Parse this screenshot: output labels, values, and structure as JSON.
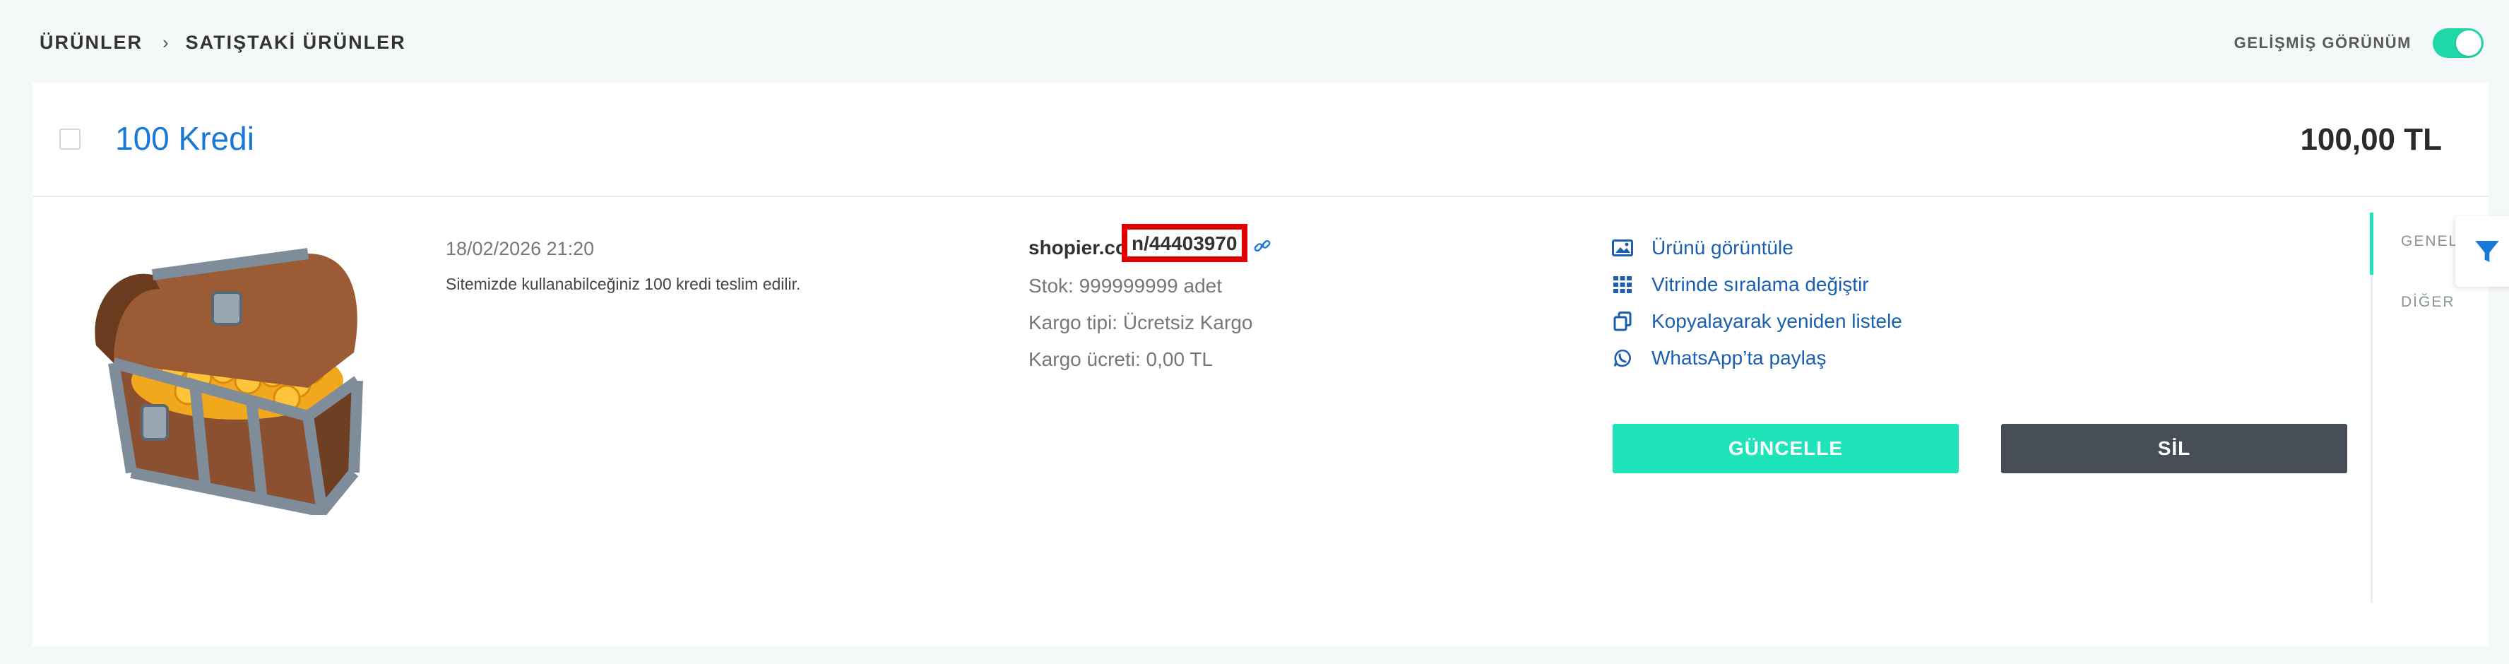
{
  "breadcrumb": {
    "root": "ÜRÜNLER",
    "separator": "›",
    "current": "SATIŞTAKİ ÜRÜNLER"
  },
  "advanced_view": {
    "label": "GELİŞMİŞ GÖRÜNÜM",
    "enabled": true
  },
  "product": {
    "title": "100 Kredi",
    "price": "100,00 TL",
    "date": "18/02/2026 21:20",
    "description": "Sitemizde kullanabilceğiniz 100 kredi teslim edilir.",
    "link_host": "shopier.co",
    "link_id": "n/44403970",
    "stock": "Stok: 999999999 adet",
    "shipping_type": "Kargo tipi: Ücretsiz Kargo",
    "shipping_fee": "Kargo ücreti: 0,00 TL"
  },
  "actions": [
    {
      "label": "Ürünü görüntüle",
      "icon": "image-icon"
    },
    {
      "label": "Vitrinde sıralama değiştir",
      "icon": "grid-icon"
    },
    {
      "label": "Kopyalayarak yeniden listele",
      "icon": "copy-icon"
    },
    {
      "label": "WhatsApp’ta paylaş",
      "icon": "whatsapp-icon"
    }
  ],
  "buttons": {
    "update": "GÜNCELLE",
    "delete": "SİL"
  },
  "side_tabs": {
    "general": "GENEL",
    "other": "DİĞER"
  },
  "colors": {
    "accent": "#1fe3b9",
    "link": "#1a78d6",
    "delete": "#474e57",
    "highlight": "#e00000"
  }
}
